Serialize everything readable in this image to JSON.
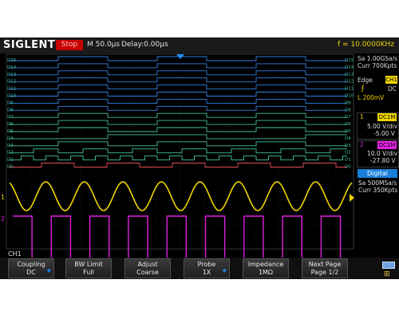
{
  "header": {
    "brand": "SIGLENT",
    "run_state": "Stop",
    "timebase": "M 50.0µs",
    "delay": "Delay:0.00µs",
    "frequency": "f = 10.0000KHz"
  },
  "acquisition": {
    "sample_rate": "Sa 1.00GSa/s",
    "memory": "Curr 700Kpts"
  },
  "trigger": {
    "type": "Edge",
    "source": "CH1",
    "slope_icon": "rising-edge-icon",
    "coupling": "DC",
    "level": "L  200mV"
  },
  "channels": [
    {
      "number": "1",
      "coupling": "DC1M",
      "scale": "5.00 V/div",
      "offset": "-5.00 V",
      "color": "#f0d400"
    },
    {
      "number": "2",
      "coupling": "DC1M",
      "scale": "10.0 V/div",
      "offset": "-27.80 V",
      "color": "#e020e0"
    }
  ],
  "digital": {
    "label": "Digital",
    "sample_rate": "Sa 500MSa/s",
    "memory": "Curr 350Kpts",
    "lines": [
      "D15",
      "D14",
      "D13",
      "D12",
      "D11",
      "D10",
      "D9",
      "D8",
      "D7",
      "D6",
      "D5",
      "D4",
      "D3",
      "D2",
      "D1",
      "D0"
    ]
  },
  "menu": {
    "title": "CH1",
    "softkeys": [
      {
        "label": "Coupling",
        "value": "DC",
        "has_arrow": true
      },
      {
        "label": "BW Limit",
        "value": "Full",
        "has_arrow": false
      },
      {
        "label": "Adjust",
        "value": "Coarse",
        "has_arrow": false
      },
      {
        "label": "Probe",
        "value": "1X",
        "has_arrow": true
      },
      {
        "label": "Impedance",
        "value": "1MΩ",
        "has_arrow": false
      },
      {
        "label": "Next Page",
        "value": "Page 1/2",
        "has_arrow": false
      }
    ]
  },
  "colors": {
    "ch1": "#f0d400",
    "ch2": "#e020e0",
    "digital_high": "#40c0a0",
    "digital_bus": "#3080e0",
    "d0": "#e05050",
    "stop": "#c80000"
  },
  "icons": [
    "usb-icon",
    "network-icon"
  ]
}
